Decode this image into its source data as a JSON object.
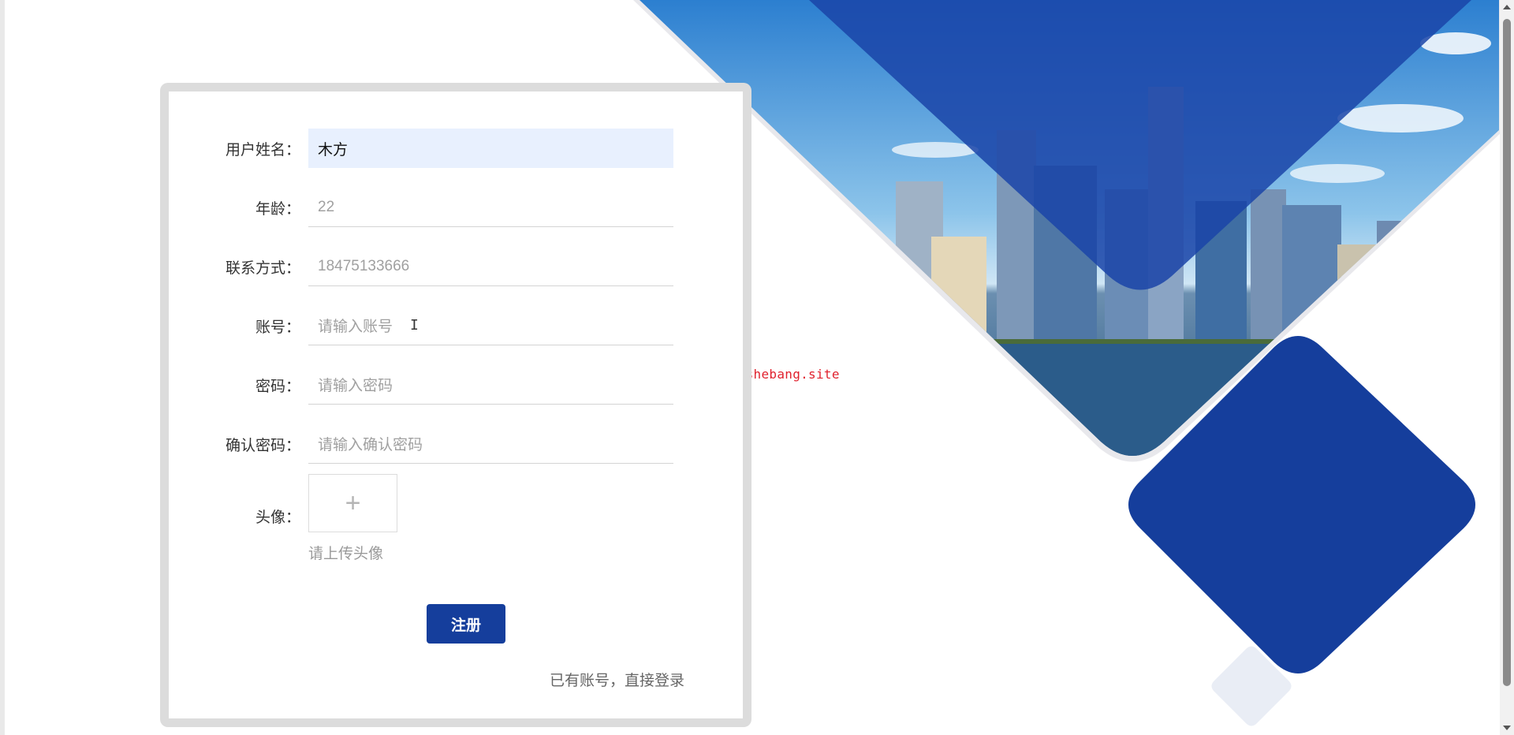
{
  "form": {
    "fields": [
      {
        "label": "用户姓名：",
        "value": "木方",
        "placeholder": ""
      },
      {
        "label": "年龄：",
        "value": "",
        "placeholder": "22"
      },
      {
        "label": "联系方式：",
        "value": "",
        "placeholder": "18475133666"
      },
      {
        "label": "账号：",
        "value": "",
        "placeholder": "请输入账号"
      },
      {
        "label": "密码：",
        "value": "",
        "placeholder": "请输入密码"
      },
      {
        "label": "确认密码：",
        "value": "",
        "placeholder": "请输入确认密码"
      }
    ],
    "avatar": {
      "label": "头像：",
      "icon": "plus-icon",
      "icon_glyph": "+",
      "hint": "请上传头像"
    },
    "submit_label": "注册",
    "login_link": "已有账号，直接登录"
  },
  "watermark": "www.bishebang.site",
  "colors": {
    "accent": "#153e9c",
    "filled_input": "#e8f0fe",
    "watermark": "#e0212d",
    "deco_blue": "#1a44a8"
  }
}
